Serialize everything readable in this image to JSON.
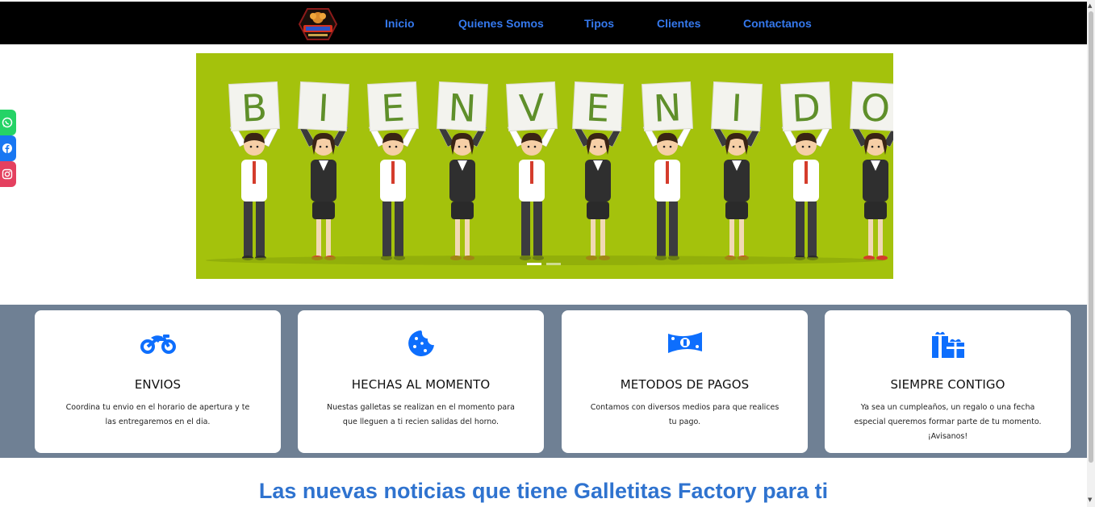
{
  "colors": {
    "nav_bg": "#000000",
    "nav_link": "#3579ee",
    "hero_bg": "#a4c20c",
    "features_bg": "#6f8094",
    "icon_blue": "#0d6efd",
    "whatsapp": "#25d366",
    "facebook": "#1877f2",
    "instagram": "#e4405f",
    "news_title": "#2f73cf"
  },
  "nav": {
    "logo_icon": "galletitas-factory-logo",
    "links": [
      {
        "label": "Inicio"
      },
      {
        "label": "Quienes Somos"
      },
      {
        "label": "Tipos"
      },
      {
        "label": "Clientes"
      },
      {
        "label": "Contactanos"
      }
    ]
  },
  "hero": {
    "banner_text": "BIENVENIDO",
    "letters": [
      "B",
      "I",
      "E",
      "N",
      "V",
      "E",
      "N",
      "I",
      "D",
      "O"
    ],
    "slide_count": 2,
    "active_slide": 1
  },
  "social": [
    {
      "icon": "whatsapp-icon"
    },
    {
      "icon": "facebook-icon"
    },
    {
      "icon": "instagram-icon"
    }
  ],
  "features": [
    {
      "icon": "motorcycle-icon",
      "title": "ENVIOS",
      "text": "Coordina tu envio en el horario de apertura y te las entregaremos en el dia."
    },
    {
      "icon": "cookie-icon",
      "title": "HECHAS AL MOMENTO",
      "text": "Nuestas galletas se realizan en el momento para que lleguen a ti recien salidas del horno."
    },
    {
      "icon": "money-bill-icon",
      "title": "METODOS DE PAGOS",
      "text": "Contamos con diversos medios para que realices tu pago."
    },
    {
      "icon": "gifts-icon",
      "title": "SIEMPRE CONTIGO",
      "text": "Ya sea un cumpleaños, un regalo o una fecha especial queremos formar parte de tu momento. ¡Avisanos!"
    }
  ],
  "news": {
    "title": "Las nuevas noticias que tiene Galletitas Factory para ti"
  }
}
